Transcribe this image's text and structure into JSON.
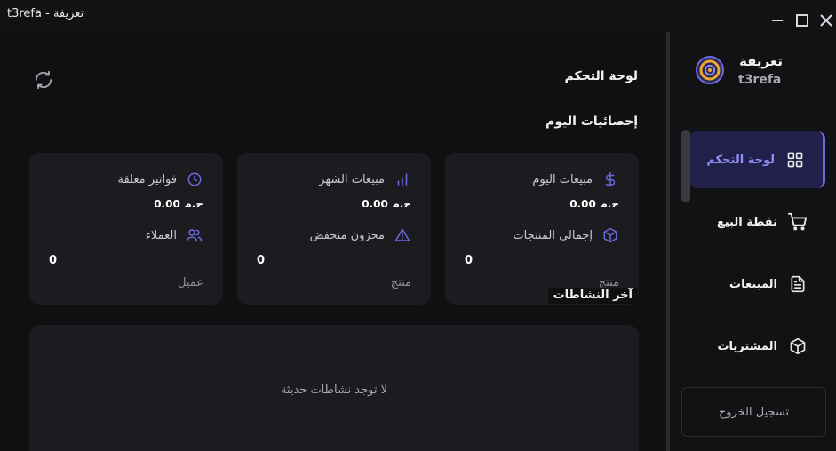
{
  "window": {
    "title": "t3refa - تعريفة"
  },
  "header": {
    "page_title": "لوحة التحكم",
    "section_title": "إحصائيات اليوم"
  },
  "cards": [
    {
      "row1_label": "مبيعات اليوم",
      "row1_icon": "dollar-icon",
      "row1_value": "0.00 ج.م",
      "row2_label": "إجمالي المنتجات",
      "row2_icon": "box-icon",
      "row2_value": "0",
      "row2_unit": "منتج"
    },
    {
      "row1_label": "مبيعات الشهر",
      "row1_icon": "bar-chart-icon",
      "row1_value": "0.00 ج.م",
      "row2_label": "مخزون منخفض",
      "row2_icon": "alert-triangle-icon",
      "row2_value": "0",
      "row2_unit": "منتج"
    },
    {
      "row1_label": "فواتير معلقة",
      "row1_icon": "clock-icon",
      "row1_value": "0.00 ج.م",
      "row2_label": "العملاء",
      "row2_icon": "users-icon",
      "row2_value": "0",
      "row2_unit": "عميل"
    }
  ],
  "activity": {
    "title": "آخر النشاطات",
    "empty_message": "لا توجد نشاطات حديثة"
  },
  "sidebar": {
    "brand_ar": "تعريفة",
    "brand_en": "t3refa",
    "items": [
      {
        "label": "لوحة التحكم",
        "icon": "grid-icon",
        "active": true
      },
      {
        "label": "نقطة البيع",
        "icon": "cart-icon",
        "active": false
      },
      {
        "label": "المبيعات",
        "icon": "document-icon",
        "active": false
      },
      {
        "label": "المشتريات",
        "icon": "box-icon",
        "active": false
      }
    ],
    "logout_label": "تسجيل الخروج"
  },
  "colors": {
    "accent": "#6a6adf",
    "card_bg": "#1c1c20",
    "bg": "#101012"
  }
}
